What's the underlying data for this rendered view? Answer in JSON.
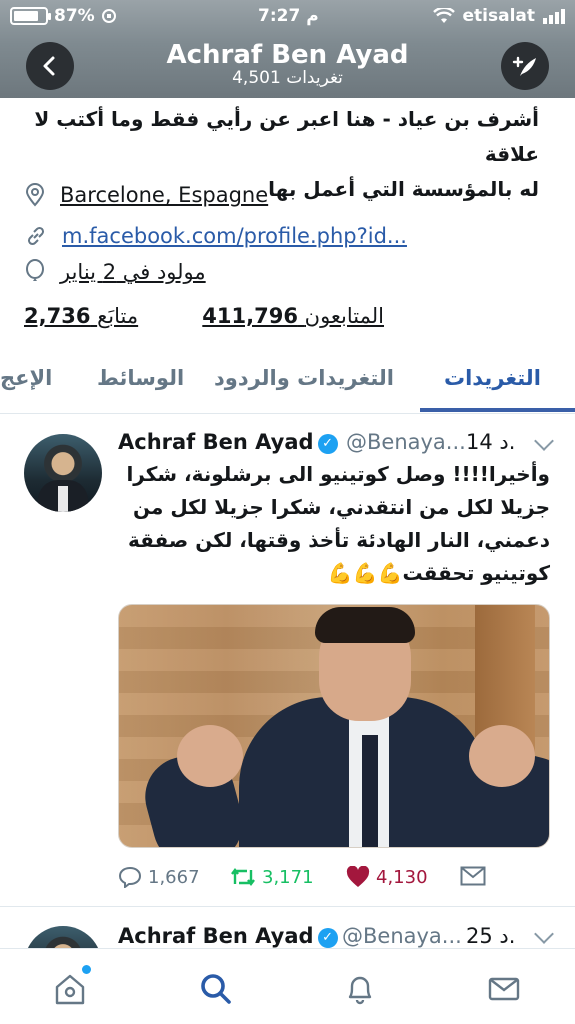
{
  "status_bar": {
    "battery": "87%",
    "time": "7:27 م",
    "carrier": "etisalat"
  },
  "header": {
    "name": "Achraf Ben Ayad",
    "tweet_count": "4,501 تغريدات",
    "back_icon": "chevron-left-icon",
    "compose_icon": "compose-tweet-icon"
  },
  "profile": {
    "bio_line1": "أشرف بن عياد - هنا اعبر عن رأيي فقط وما أكتب لا علاقة",
    "bio_line2": "له بالمؤسسة التي أعمل بها",
    "location": "Barcelone, Espagne",
    "link": "m.facebook.com/profile.php?id...",
    "birthday": "مولود في 2 يناير",
    "following_count": "2,736",
    "following_label": "متابَع",
    "followers_count": "411,796",
    "followers_label": "المتابعون"
  },
  "tabs": {
    "tweets": "التغريدات",
    "tweets_replies": "التغريدات والردود",
    "media": "الوسائط",
    "likes": "الإعج"
  },
  "tweets": [
    {
      "name": "Achraf Ben Ayad",
      "handle": "@Benaya...",
      "time": "14 د.",
      "text_line1": "وأخيرا!!!! وصل كوتينيو الى برشلونة، شكرا",
      "text_line2": "جزيلا لكل من انتقدني، شكرا جزيلا  لكل من",
      "text_line3": "دعمني، النار الهادئة تأخذ وقتها، لكن صفقة",
      "text_line4": "كوتينيو تحققت💪💪💪",
      "replies": "1,667",
      "retweets": "3,171",
      "likes": "4,130"
    },
    {
      "name": "Achraf Ben Ayad",
      "handle": "@Benaya...",
      "time": "25 د."
    }
  ],
  "colors": {
    "accent": "#1da1f2",
    "tab_active": "#2a5ba8",
    "retweet": "#17bf63",
    "like": "#e0245e",
    "like_text": "#a3173d"
  },
  "bottom_nav": [
    "home-icon",
    "search-icon",
    "notifications-icon",
    "messages-icon"
  ]
}
